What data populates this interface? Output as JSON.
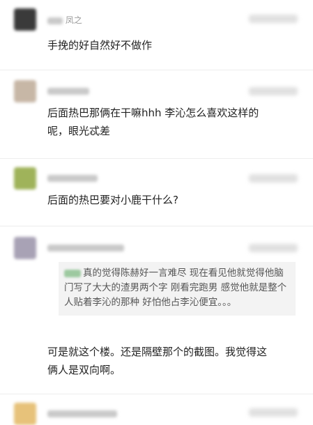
{
  "comments": [
    {
      "user": "凤之",
      "text": "手挽的好自然好不做作",
      "avatar_color": "#3a3a3a"
    },
    {
      "user": "",
      "text": "后面热巴那俩在干嘛hhh 李沁怎么喜欢这样的呢，眼光忒差",
      "avatar_color": "#c7b7a6"
    },
    {
      "user": "",
      "text": "后面的热巴要对小鹿干什么?",
      "avatar_color": "#9fb35a"
    },
    {
      "user": "",
      "quote": "真的觉得陈赫好一言难尽 现在看见他就觉得他脑门写了大大的渣男两个字 刚看完跑男 感觉他就是整个人贴着李沁的那种 好怕他占李沁便宜。。。",
      "text": "可是就这个楼。还是隔壁那个的截图。我觉得这俩人是双向啊。",
      "avatar_color": "#a8a2b5"
    },
    {
      "user": "",
      "text": "",
      "avatar_color": "#e7c27a"
    }
  ]
}
